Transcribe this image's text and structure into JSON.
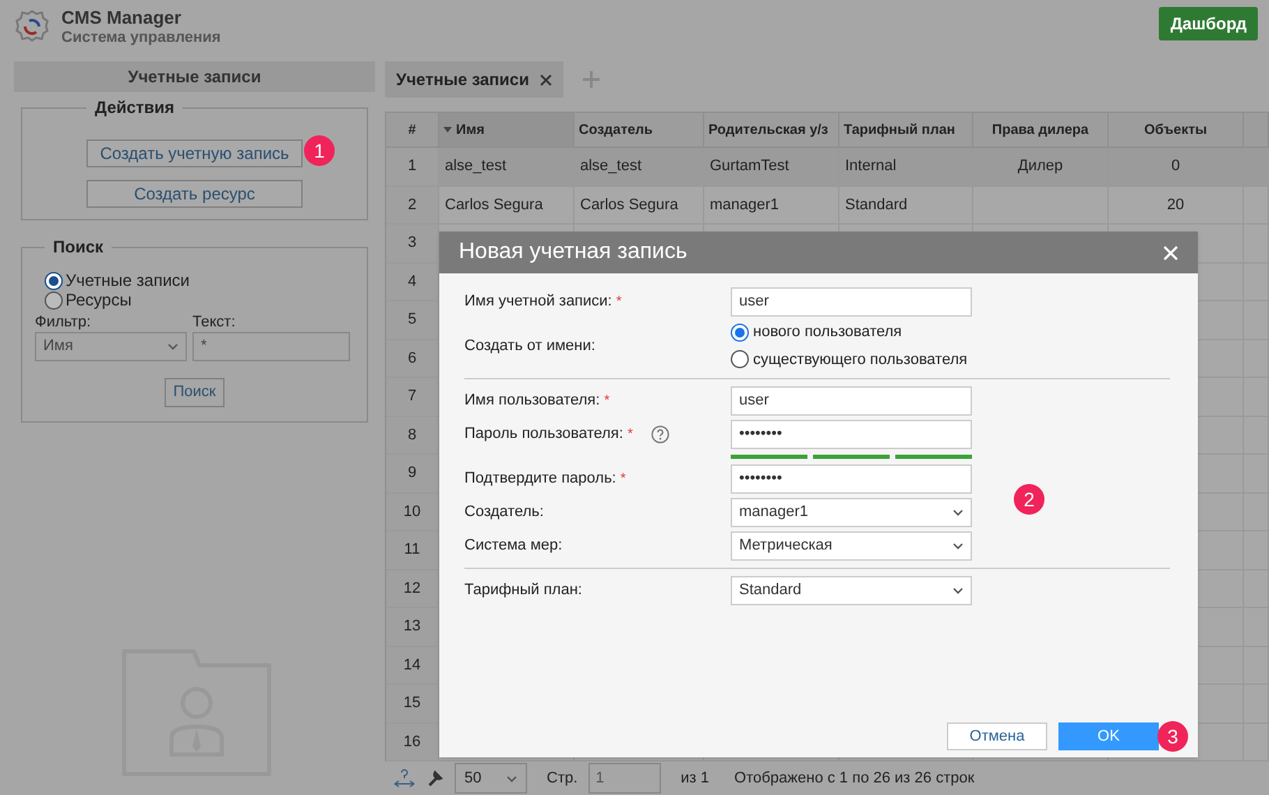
{
  "header": {
    "title": "CMS Manager",
    "subtitle": "Система управления",
    "dashboard_button": "Дашборд"
  },
  "sidebar": {
    "title": "Учетные записи",
    "actions": {
      "legend": "Действия",
      "buttons": [
        {
          "label": "Создать учетную запись",
          "marker": "1"
        },
        {
          "label": "Создать ресурс"
        }
      ]
    },
    "search": {
      "legend": "Поиск",
      "options": [
        {
          "label": "Учетные записи",
          "selected": true
        },
        {
          "label": "Ресурсы",
          "selected": false
        }
      ],
      "filter_label": "Фильтр:",
      "filter_value": "Имя",
      "text_label": "Текст:",
      "text_value": "*",
      "button": "Поиск"
    }
  },
  "tabs": [
    {
      "label": "Учетные записи",
      "selected": true
    }
  ],
  "table": {
    "columns": [
      {
        "label": "#",
        "sorted": false
      },
      {
        "label": "Имя",
        "sorted": true
      },
      {
        "label": "Создатель",
        "sorted": false
      },
      {
        "label": "Родительская у/з",
        "sorted": false
      },
      {
        "label": "Тарифный план",
        "sorted": false
      },
      {
        "label": "Права дилера",
        "sorted": false
      },
      {
        "label": "Объекты",
        "sorted": false
      }
    ],
    "rows": [
      {
        "selected": true,
        "cells": [
          "1",
          "alse_test",
          "alse_test",
          "GurtamTest",
          "Internal",
          "Дилер",
          "0"
        ]
      },
      {
        "selected": false,
        "cells": [
          "2",
          "Carlos Segura",
          "Carlos Segura",
          "manager1",
          "Standard",
          "",
          "20"
        ]
      },
      {
        "selected": false,
        "cells": [
          "3"
        ]
      },
      {
        "selected": false,
        "cells": [
          "4"
        ]
      },
      {
        "selected": false,
        "cells": [
          "5"
        ]
      },
      {
        "selected": false,
        "cells": [
          "6"
        ]
      },
      {
        "selected": false,
        "cells": [
          "7"
        ]
      },
      {
        "selected": false,
        "cells": [
          "8"
        ]
      },
      {
        "selected": false,
        "cells": [
          "9"
        ]
      },
      {
        "selected": false,
        "cells": [
          "10"
        ]
      },
      {
        "selected": false,
        "cells": [
          "11"
        ]
      },
      {
        "selected": false,
        "cells": [
          "12"
        ]
      },
      {
        "selected": false,
        "cells": [
          "13"
        ]
      },
      {
        "selected": false,
        "cells": [
          "14"
        ]
      },
      {
        "selected": false,
        "cells": [
          "15"
        ]
      },
      {
        "selected": false,
        "cells": [
          "16"
        ]
      }
    ]
  },
  "pager": {
    "page_size": "50",
    "page_label": "Стр.",
    "page": "1",
    "of": "из 1",
    "status": "Отображено с 1 по 26 из 26 строк"
  },
  "dialog": {
    "title": "Новая учетная запись",
    "fields": [
      {
        "kind": "input",
        "label": "Имя учетной записи:",
        "required": true,
        "value": "user"
      },
      {
        "kind": "radio",
        "label": "Создать от имени:",
        "options": [
          {
            "label": "нового пользователя",
            "selected": true
          },
          {
            "label": "существующего пользователя",
            "selected": false
          }
        ]
      },
      {
        "kind": "divider"
      },
      {
        "kind": "input",
        "label": "Имя пользователя:",
        "required": true,
        "value": "user"
      },
      {
        "kind": "password",
        "label": "Пароль пользователя:",
        "required": true,
        "help": true,
        "value": "••••••••",
        "strength_bars": [
          {
            "filled": true
          },
          {
            "filled": true
          },
          {
            "filled": true
          }
        ]
      },
      {
        "kind": "password",
        "label": "Подтвердите пароль:",
        "required": true,
        "value": "••••••••"
      },
      {
        "kind": "select",
        "label": "Создатель:",
        "required": false,
        "value": "manager1"
      },
      {
        "kind": "select",
        "label": "Система мер:",
        "required": false,
        "value": "Метрическая"
      },
      {
        "kind": "divider"
      },
      {
        "kind": "select",
        "label": "Тарифный план:",
        "required": false,
        "value": "Standard"
      }
    ],
    "marker": "2",
    "cancel": "Отмена",
    "ok": "OK",
    "ok_marker": "3"
  }
}
